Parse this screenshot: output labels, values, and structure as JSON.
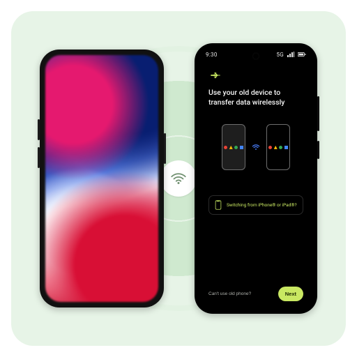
{
  "icons": {
    "wifi_center": "wifi-icon",
    "arrows": "transfer-arrows-icon",
    "iphone_outline": "iphone-outline-icon"
  },
  "left_phone": {
    "wallpaper": "abstract-red-white-blue-gradient"
  },
  "right_phone": {
    "statusbar": {
      "time": "9:30",
      "network_label": "5G",
      "signal_bars": 3
    },
    "setup": {
      "title": "Use your old device to transfer data wirelessly"
    },
    "switching_banner": {
      "text": "Switching from iPhone® or iPad®?"
    },
    "footer": {
      "skip_label": "Can't use old phone?",
      "next_label": "Next"
    }
  },
  "colors": {
    "card_bg": "#e7f4e7",
    "ring": "#cfe9cf",
    "accent_lime": "#c9e862"
  }
}
